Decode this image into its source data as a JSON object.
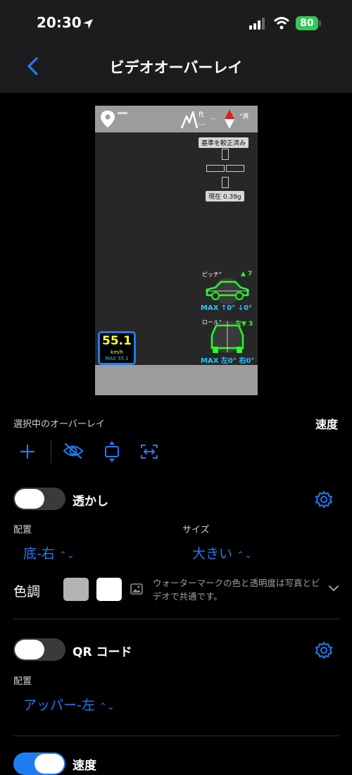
{
  "status": {
    "time": "20:30",
    "battery": "80"
  },
  "nav": {
    "title": "ビデオオーバーレイ",
    "back": "<"
  },
  "preview": {
    "altitude_unit": "ft",
    "altitude_value": "---",
    "dash": "--",
    "north": "°真",
    "calibrated": "基準を較正済み",
    "gforce": "現在 0.39g",
    "pitch_label": "ピッチ°",
    "pitch_value": "▲ 7",
    "pitch_max": "MAX ↑0° ↓0°",
    "roll_label": "ロール°",
    "roll_value": "左▼ 3",
    "roll_max": "MAX 左0° 右0°",
    "speed_value": "55.1",
    "speed_unit": "km/h",
    "speed_max": "MAX 55.1"
  },
  "selected": {
    "label": "選択中のオーバーレイ",
    "value": "速度"
  },
  "watermark": {
    "title": "透かし",
    "enabled": false,
    "placement_label": "配置",
    "placement_value": "底-右",
    "size_label": "サイズ",
    "size_value": "大きい",
    "tone_label": "色調",
    "swatch_colors": [
      "#b3b3b3",
      "#ffffff"
    ],
    "note": "ウォーターマークの色と透明度は写真とビデオで共通です。"
  },
  "qr": {
    "title": "QR コード",
    "enabled": false,
    "placement_label": "配置",
    "placement_value": "アッパー-左"
  },
  "speed": {
    "title": "速度",
    "enabled": true
  },
  "colors": {
    "accent": "#1e7cf2",
    "overlay_green": "#22ff22",
    "overlay_cyan": "#27c6ff",
    "speed_yellow": "#ffff33"
  }
}
